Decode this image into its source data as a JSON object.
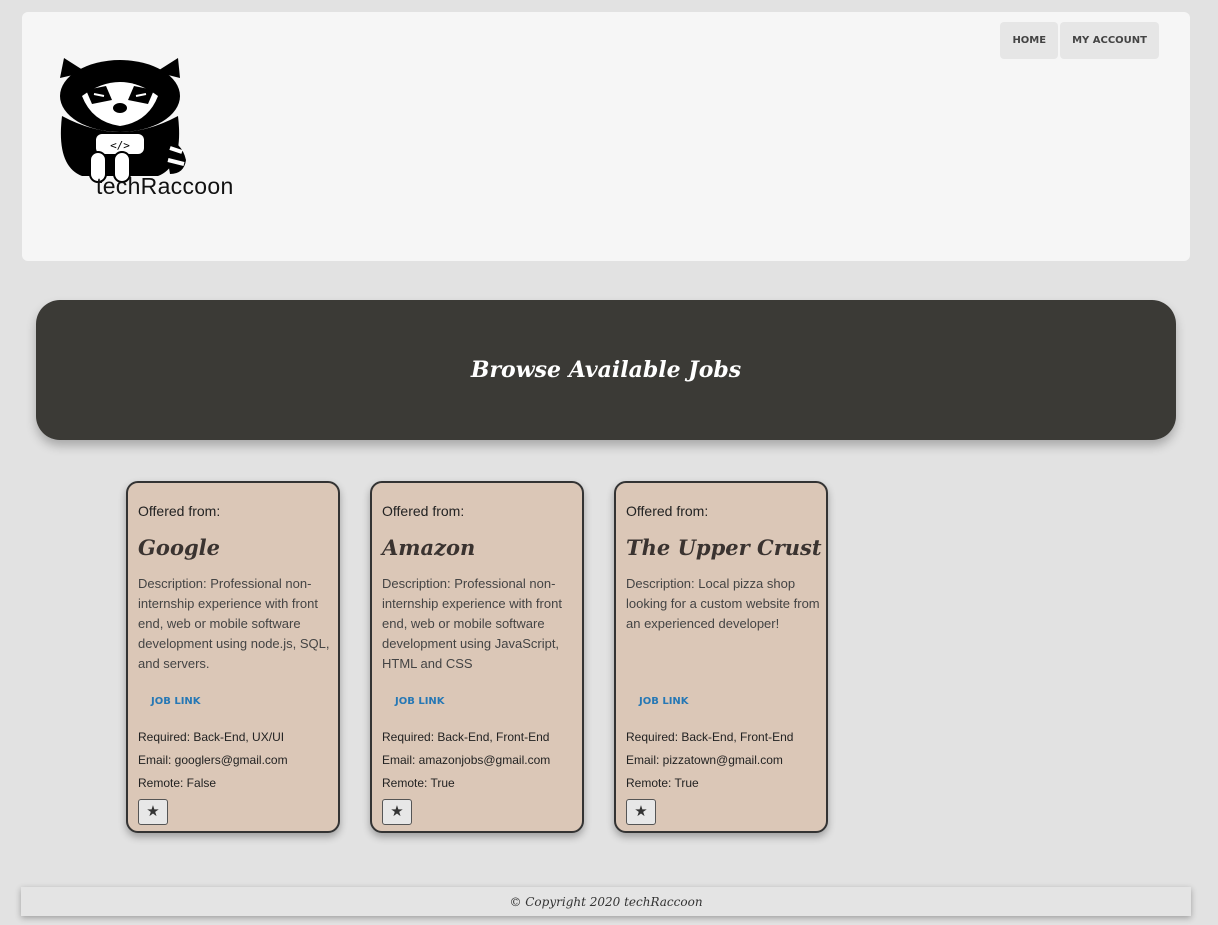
{
  "brand": {
    "name": "techRaccoon"
  },
  "nav": {
    "home": "HOME",
    "account": "MY ACCOUNT"
  },
  "banner": {
    "title": "Browse Available Jobs"
  },
  "jobs": [
    {
      "offered_label": "Offered from:",
      "company": "Google",
      "description": "Description: Professional non-internship experience with front end, web or mobile software development using node.js, SQL, and servers.",
      "link_label": "JOB LINK",
      "required": "Required: Back-End, UX/UI",
      "email": "Email: googlers@gmail.com",
      "remote": "Remote: False"
    },
    {
      "offered_label": "Offered from:",
      "company": "Amazon",
      "description": "Description: Professional non-internship experience with front end, web or mobile software development using JavaScript, HTML and CSS",
      "link_label": "JOB LINK",
      "required": "Required: Back-End, Front-End",
      "email": "Email: amazonjobs@gmail.com",
      "remote": "Remote: True"
    },
    {
      "offered_label": "Offered from:",
      "company": "The Upper Crust",
      "description": "Description: Local pizza shop looking for a custom website from an experienced developer!",
      "link_label": "JOB LINK",
      "required": "Required: Back-End, Front-End",
      "email": "Email: pizzatown@gmail.com",
      "remote": "Remote: True"
    }
  ],
  "favorite_icon": "star-icon",
  "footer": {
    "text": "© Copyright 2020 techRaccoon"
  },
  "colors": {
    "page_bg": "#e2e2e2",
    "banner_bg": "#3b3a36",
    "card_bg": "#dbc7b7",
    "link": "#2678b5"
  }
}
